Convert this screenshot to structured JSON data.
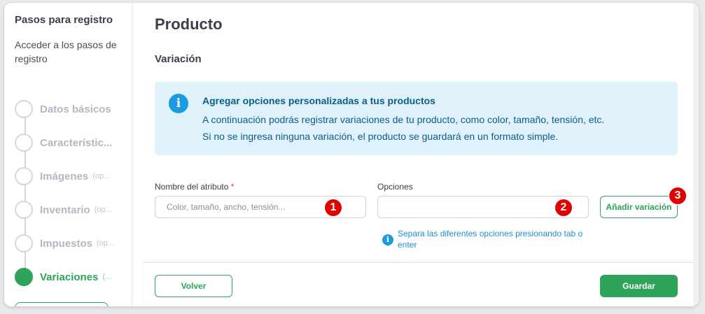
{
  "sidebar": {
    "title": "Pasos para registro",
    "subtitle": "Acceder a los pasos de registro",
    "steps": [
      {
        "label": "Datos básicos",
        "optional": ""
      },
      {
        "label": "Característic...",
        "optional": ""
      },
      {
        "label": "Imágenes",
        "optional": "(op..."
      },
      {
        "label": "Inventario",
        "optional": "(op..."
      },
      {
        "label": "Impuestos",
        "optional": "(op..."
      },
      {
        "label": "Variaciones",
        "optional": "(..."
      }
    ]
  },
  "main": {
    "title": "Producto",
    "section": "Variación",
    "info": {
      "icon": "info-icon",
      "title": "Agregar opciones personalizadas a tus productos",
      "line1": "A continuación podrás registrar variaciones de tu producto, como color, tamaño, tensión, etc.",
      "line2": "Si no se ingresa ninguna variación, el producto se guardará en un formato simple."
    },
    "attribute": {
      "label": "Nombre del atributo",
      "required_mark": "*",
      "value": "",
      "placeholder": "Color, tamaño, ancho, tensión..."
    },
    "options": {
      "label": "Opciones",
      "value": "",
      "placeholder": ""
    },
    "add_variation_label": "Añadir variación",
    "hint": "Separa las diferentes opciones presionando tab o enter",
    "badges": [
      "1",
      "2",
      "3"
    ]
  },
  "footer": {
    "back_label": "Volver",
    "save_label": "Guardar"
  },
  "colors": {
    "accent": "#2ea35a",
    "info_bg": "#dff1fb",
    "info_text": "#0c5e86",
    "badge": "#e00000"
  }
}
